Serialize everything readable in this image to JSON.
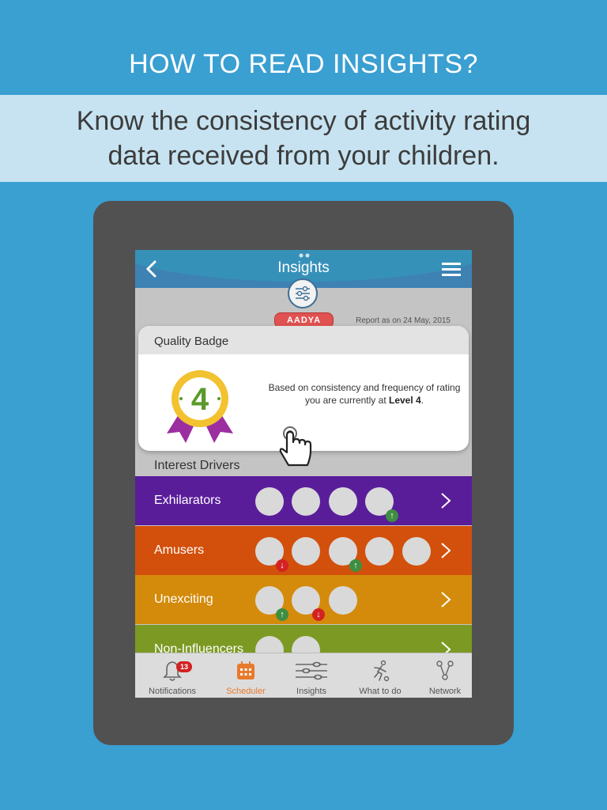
{
  "promo": {
    "title": "HOW TO READ INSIGHTS?",
    "subtitle": "Know the consistency of activity rating data received from your children."
  },
  "app": {
    "page_title": "Insights",
    "child_name": "AADYA",
    "report_date": "Report as on 24 May, 2015"
  },
  "quality_badge": {
    "title": "Quality Badge",
    "level_number": "4",
    "text_before": "Based on consistency and frequency of rating you are currently at ",
    "level_label": "Level 4",
    "text_after": "."
  },
  "interest_drivers": {
    "title": "Interest Drivers",
    "rows": [
      {
        "label": "Exhilarators",
        "color": "#5a1d9a",
        "circles": [
          "none",
          "none",
          "none",
          "up"
        ]
      },
      {
        "label": "Amusers",
        "color": "#d2500c",
        "circles": [
          "down",
          "none",
          "up",
          "none",
          "none"
        ]
      },
      {
        "label": "Unexciting",
        "color": "#d48b0b",
        "circles": [
          "up",
          "down",
          "none"
        ]
      },
      {
        "label": "Non-Influencers",
        "color": "#7c9a23",
        "circles": [
          "none",
          "none"
        ]
      }
    ]
  },
  "bottom_nav": {
    "notifications": {
      "label": "Notifications",
      "badge": "13"
    },
    "scheduler": {
      "label": "Scheduler"
    },
    "insights": {
      "label": "Insights"
    },
    "what_to_do": {
      "label": "What to do"
    },
    "network": {
      "label": "Network"
    }
  },
  "colors": {
    "background": "#3a9fd1",
    "appbar": "#3e82b4",
    "active_nav": "#e87a2e",
    "badge_gold": "#f2c230",
    "ribbon": "#9b2fa0"
  }
}
